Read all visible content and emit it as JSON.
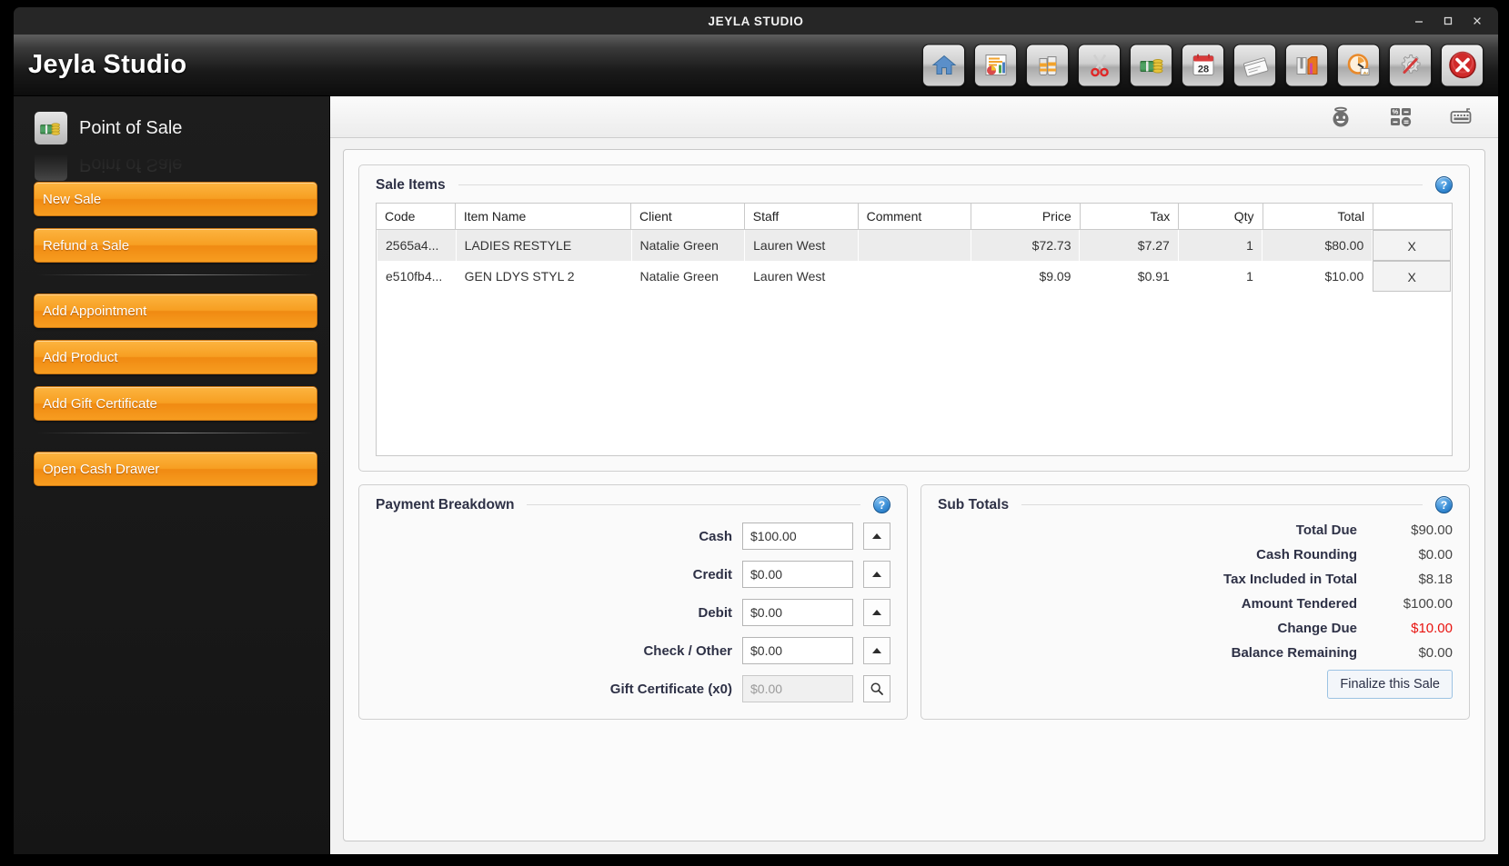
{
  "window": {
    "title": "JEYLA STUDIO",
    "controls": [
      {
        "name": "minimize-button",
        "glyph": "minimize"
      },
      {
        "name": "maximize-button",
        "glyph": "maximize"
      },
      {
        "name": "close-button",
        "glyph": "close"
      }
    ]
  },
  "header": {
    "brand": "Jeyla Studio",
    "toolbar": [
      {
        "name": "home-icon",
        "label": "Home"
      },
      {
        "name": "reports-icon",
        "label": "Reports"
      },
      {
        "name": "products-icon",
        "label": "Products"
      },
      {
        "name": "services-icon",
        "label": "Services"
      },
      {
        "name": "point-of-sale-icon",
        "label": "Point of Sale"
      },
      {
        "name": "calendar-icon",
        "label": "Calendar",
        "day": "28"
      },
      {
        "name": "vouchers-icon",
        "label": "Vouchers"
      },
      {
        "name": "retail-icon",
        "label": "Retail"
      },
      {
        "name": "timeclock-icon",
        "label": "Time Clock"
      },
      {
        "name": "settings-icon",
        "label": "Settings"
      },
      {
        "name": "exit-icon",
        "label": "Exit"
      }
    ]
  },
  "sidebar": {
    "section_icon": "money-icon",
    "section_title": "Point of Sale",
    "buttons": [
      {
        "name": "new-sale-button",
        "label": "New Sale"
      },
      {
        "name": "refund-a-sale-button",
        "label": "Refund a Sale"
      },
      {
        "name": "add-appointment-button",
        "label": "Add Appointment"
      },
      {
        "name": "add-product-button",
        "label": "Add Product"
      },
      {
        "name": "add-gift-certificate-button",
        "label": "Add Gift Certificate"
      },
      {
        "name": "open-cash-drawer-button",
        "label": "Open Cash Drawer"
      }
    ]
  },
  "subbar": {
    "icons": [
      {
        "name": "client-happy-icon",
        "label": "Client"
      },
      {
        "name": "calculator-icon",
        "label": "Calculator"
      },
      {
        "name": "keyboard-icon",
        "label": "Keyboard"
      }
    ]
  },
  "sale_items": {
    "title": "Sale Items",
    "help": "?",
    "columns": [
      "Code",
      "Item Name",
      "Client",
      "Staff",
      "Comment",
      "Price",
      "Tax",
      "Qty",
      "Total"
    ],
    "rows": [
      {
        "code": "2565a4...",
        "item_name": "LADIES RESTYLE",
        "client": "Natalie Green",
        "staff": "Lauren West",
        "comment": "",
        "price": "$72.73",
        "tax": "$7.27",
        "qty": "1",
        "total": "$80.00",
        "delete": "X"
      },
      {
        "code": "e510fb4...",
        "item_name": "GEN LDYS STYL 2",
        "client": "Natalie Green",
        "staff": "Lauren West",
        "comment": "",
        "price": "$9.09",
        "tax": "$0.91",
        "qty": "1",
        "total": "$10.00",
        "delete": "X"
      }
    ]
  },
  "payment_breakdown": {
    "title": "Payment Breakdown",
    "help": "?",
    "fields": [
      {
        "name": "cash",
        "label": "Cash",
        "value": "$100.00",
        "control": "spinner",
        "disabled": false
      },
      {
        "name": "credit",
        "label": "Credit",
        "value": "$0.00",
        "control": "spinner",
        "disabled": false
      },
      {
        "name": "debit",
        "label": "Debit",
        "value": "$0.00",
        "control": "spinner",
        "disabled": false
      },
      {
        "name": "check-other",
        "label": "Check / Other",
        "value": "$0.00",
        "control": "spinner",
        "disabled": false
      },
      {
        "name": "gift-certificate",
        "label": "Gift Certificate (x0)",
        "value": "$0.00",
        "control": "search",
        "disabled": true
      }
    ]
  },
  "sub_totals": {
    "title": "Sub Totals",
    "help": "?",
    "rows": [
      {
        "name": "total-due",
        "label": "Total Due",
        "value": "$90.00",
        "danger": false
      },
      {
        "name": "cash-rounding",
        "label": "Cash Rounding",
        "value": "$0.00",
        "danger": false
      },
      {
        "name": "tax-included-in-total",
        "label": "Tax Included in Total",
        "value": "$8.18",
        "danger": false
      },
      {
        "name": "amount-tendered",
        "label": "Amount Tendered",
        "value": "$100.00",
        "danger": false
      },
      {
        "name": "change-due",
        "label": "Change Due",
        "value": "$10.00",
        "danger": true
      },
      {
        "name": "balance-remaining",
        "label": "Balance Remaining",
        "value": "$0.00",
        "danger": false
      }
    ],
    "finalize_label": "Finalize this Sale"
  },
  "colors": {
    "accent_orange": "#f79f22",
    "label_navy": "#2e3146",
    "danger_red": "#e8130f",
    "help_blue": "#3a8ed6"
  }
}
